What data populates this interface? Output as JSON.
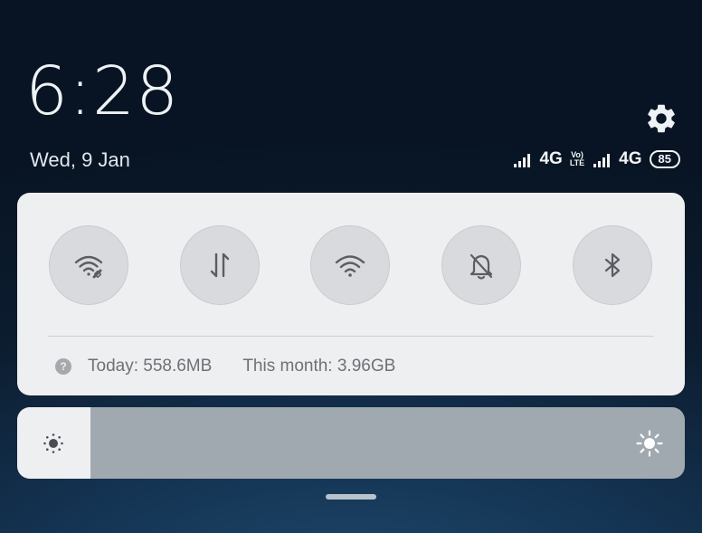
{
  "time": "6:28",
  "date": "Wed, 9 Jan",
  "status_bar": {
    "sim1_network": "4G",
    "volte_top": "Vo)",
    "volte_bottom": "LTE",
    "sim2_network": "4G",
    "battery": "85"
  },
  "tiles": [
    {
      "icon": "wifi-data-saver-icon",
      "state": "off"
    },
    {
      "icon": "mobile-data-icon",
      "state": "off"
    },
    {
      "icon": "wifi-icon",
      "state": "off"
    },
    {
      "icon": "silent-mode-icon",
      "state": "off"
    },
    {
      "icon": "bluetooth-icon",
      "state": "off"
    }
  ],
  "data_usage": {
    "help_glyph": "?",
    "today": "Today: 558.6MB",
    "month": "This month: 3.96GB"
  },
  "brightness": {
    "level": 0.11
  },
  "colors": {
    "panel": "#eeeff1",
    "tile": "#d8dadd",
    "slider_track": "#a1a9b0",
    "icon": "#5a5e63"
  }
}
